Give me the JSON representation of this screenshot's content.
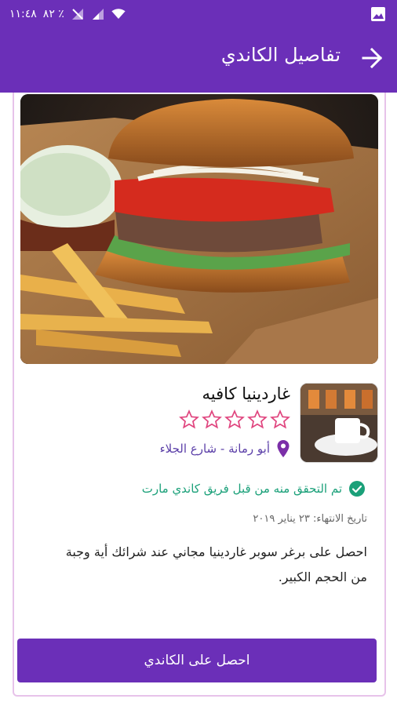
{
  "status_bar": {
    "time": "١١:٤٨",
    "battery": "٨٢ ٪"
  },
  "app_bar": {
    "title": "تفاصيل الكاندي",
    "back_icon": "arrow-back-icon"
  },
  "vendor": {
    "name": "غاردينيا كافيه",
    "rating": 0,
    "max_rating": 5,
    "location": "أبو رمانة - شارع الجلاء"
  },
  "verification": {
    "text": "تم التحقق منه من قبل فريق كاندي مارت"
  },
  "expiry": {
    "text": "تاريخ الانتهاء: ٢٣ يناير ٢٠١٩"
  },
  "offer": {
    "description": "احصل على برغر سوبر غاردينيا مجاني عند شرائك أية وجبة من الحجم الكبير."
  },
  "cta": {
    "label": "احصل على الكاندي"
  },
  "colors": {
    "primary": "#6b2fb8",
    "accent_star": "#e0467f",
    "verified": "#1aa079",
    "location_icon": "#7b2fa8"
  }
}
